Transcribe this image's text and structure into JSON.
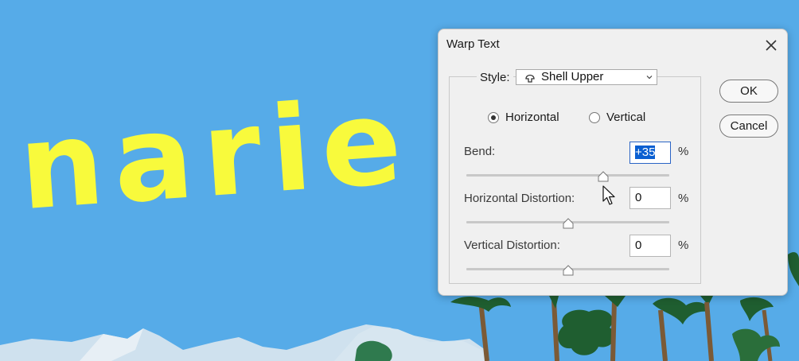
{
  "canvas": {
    "text": "narie",
    "text_color": "#f8fa3c",
    "sky_color": "#56abe8"
  },
  "dialog": {
    "title": "Warp Text",
    "style": {
      "label": "Style:",
      "value": "Shell Upper"
    },
    "orientation": {
      "horizontal_label": "Horizontal",
      "vertical_label": "Vertical",
      "selected": "Horizontal"
    },
    "bend": {
      "label": "Bend:",
      "value": "+35",
      "unit": "%",
      "slider_fraction": 0.675
    },
    "h_distortion": {
      "label": "Horizontal Distortion:",
      "value": "0",
      "unit": "%",
      "slider_fraction": 0.5
    },
    "v_distortion": {
      "label": "Vertical Distortion:",
      "value": "0",
      "unit": "%",
      "slider_fraction": 0.5
    },
    "ok_label": "OK",
    "cancel_label": "Cancel"
  }
}
